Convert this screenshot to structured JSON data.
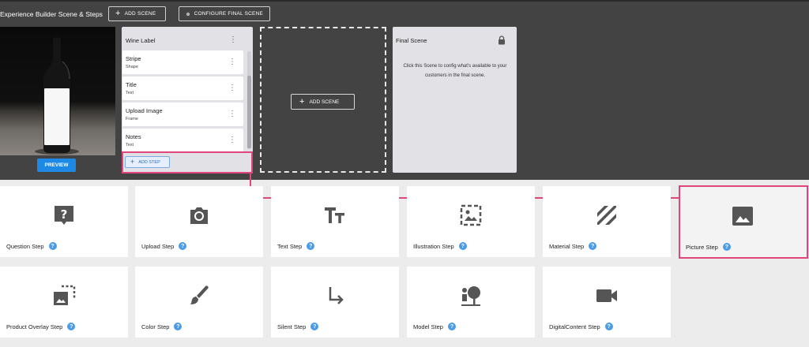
{
  "header": {
    "title": "Experience Builder Scene & Steps",
    "add_scene_label": "ADD SCENE",
    "configure_final_label": "CONFIGURE FINAL SCENE"
  },
  "scene": {
    "preview_label": "PREVIEW"
  },
  "wine_label": {
    "title": "Wine Label",
    "steps": [
      {
        "name": "Stripe",
        "type": "Shape"
      },
      {
        "name": "Title",
        "type": "Text"
      },
      {
        "name": "Upload Image",
        "type": "Frame"
      },
      {
        "name": "Notes",
        "type": "Text"
      }
    ],
    "add_step_label": "ADD STEP"
  },
  "empty_scene": {
    "add_scene_label": "ADD SCENE"
  },
  "final_scene": {
    "title": "Final Scene",
    "description": "Click this Scene to config what's available to your customers in the final scene."
  },
  "step_types": [
    {
      "label": "Question Step",
      "icon": "question-bubble-icon"
    },
    {
      "label": "Upload Step",
      "icon": "camera-icon"
    },
    {
      "label": "Text Step",
      "icon": "text-icon"
    },
    {
      "label": "Illustration Step",
      "icon": "illustration-icon"
    },
    {
      "label": "Material Step",
      "icon": "material-stripes-icon"
    },
    {
      "label": "Picture Step",
      "icon": "picture-icon"
    },
    {
      "label": "Product Overlay Step",
      "icon": "product-overlay-icon"
    },
    {
      "label": "Color Step",
      "icon": "brush-icon"
    },
    {
      "label": "Silent Step",
      "icon": "arrow-down-right-icon"
    },
    {
      "label": "Model Step",
      "icon": "model-icon"
    },
    {
      "label": "DigitalContent Step",
      "icon": "video-camera-icon"
    }
  ],
  "colors": {
    "accent": "#1e88e5",
    "highlight": "#e0457b",
    "dark_bg": "#434343"
  }
}
